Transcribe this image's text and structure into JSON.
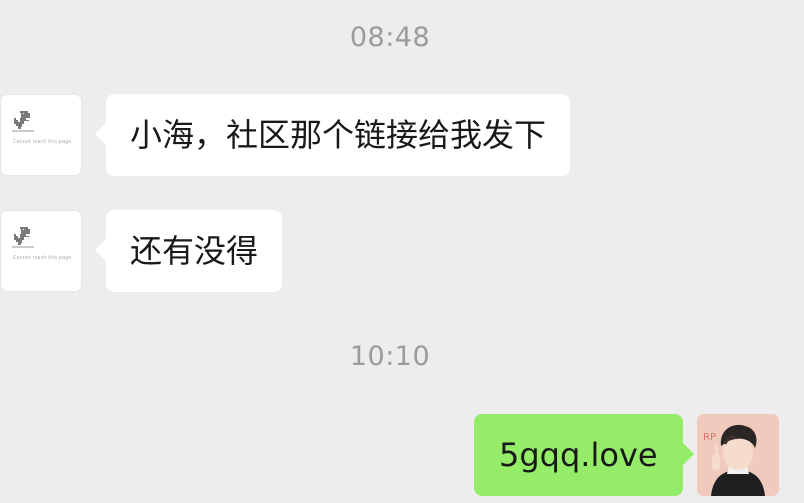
{
  "messages": [
    {
      "type": "time",
      "text": "08:48"
    },
    {
      "type": "received",
      "text": "小海，社区那个链接给我发下"
    },
    {
      "type": "received",
      "text": "还有没得"
    },
    {
      "type": "time",
      "text": "10:10"
    },
    {
      "type": "sent",
      "text": "5gqq.love"
    }
  ],
  "contact_avatar": {
    "icon": "dinosaur-icon",
    "caption": "Cannot reach this page"
  },
  "self_avatar": {
    "icon": "person-photo"
  },
  "colors": {
    "background": "#ededed",
    "received_bubble": "#ffffff",
    "sent_bubble": "#95ec69",
    "timestamp": "#9b9b9b"
  }
}
